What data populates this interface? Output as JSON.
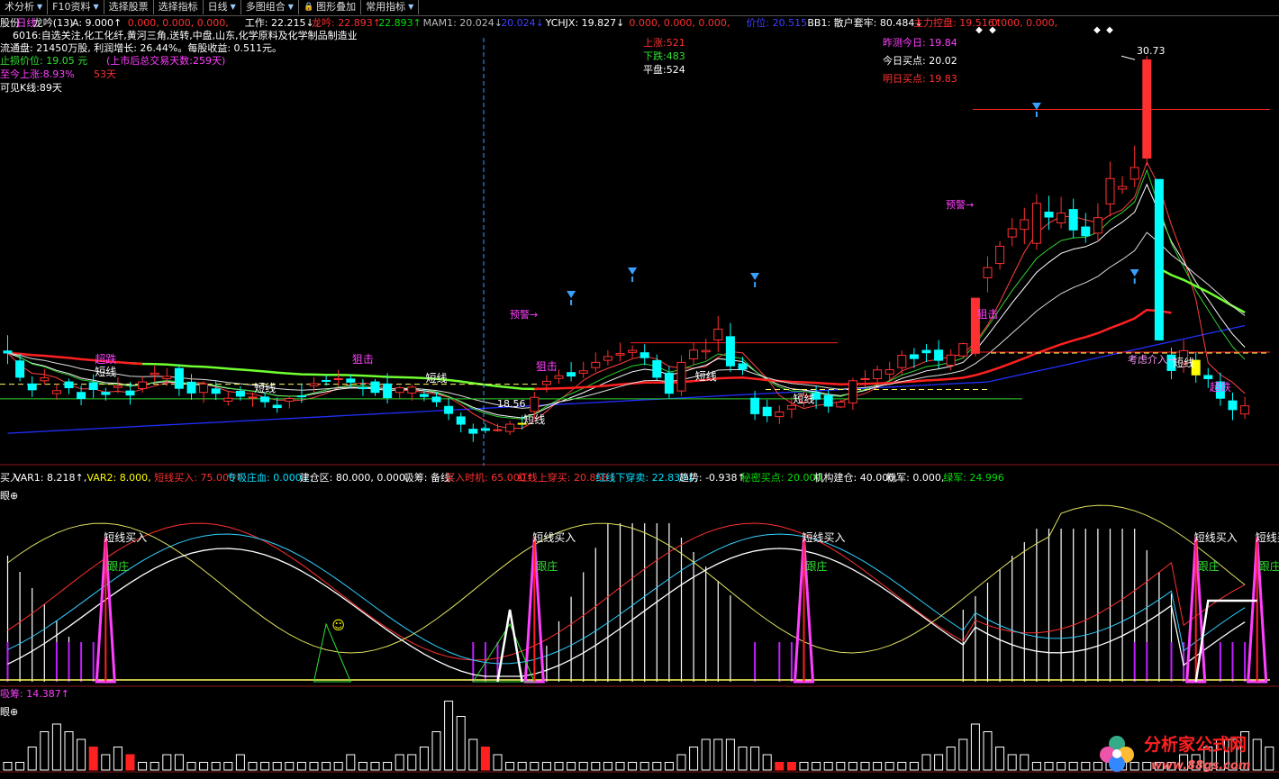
{
  "toolbar": {
    "items": [
      {
        "label": "术分析",
        "icon": "chevron-down-icon"
      },
      {
        "label": "F10资料",
        "icon": "chevron-down-icon"
      },
      {
        "label": "选择股票",
        "icon": ""
      },
      {
        "label": "选择指标",
        "icon": ""
      },
      {
        "label": "日线",
        "icon": "chevron-down-icon"
      },
      {
        "label": "多图组合",
        "icon": "chevron-down-icon"
      },
      {
        "label": "图形叠加",
        "icon": "lock-icon"
      },
      {
        "label": "常用指标",
        "icon": "chevron-down-icon"
      }
    ]
  },
  "header": {
    "line1": [
      {
        "text": "股份",
        "color": "#ffffff"
      },
      {
        "text": "日线",
        "color": "#ff4dff"
      },
      {
        "text": "龙吟(13)",
        "color": "#ffffff"
      },
      {
        "text": "A: 9.000↑",
        "color": "#ffffff"
      },
      {
        "text": "0.000, 0.000, 0.000,",
        "color": "#ff3030"
      },
      {
        "text": "工作: 22.215↓",
        "color": "#ffffff"
      },
      {
        "text": "龙吟: 22.893↑",
        "color": "#ff3030"
      },
      {
        "text": "22.893↑",
        "color": "#00e000"
      },
      {
        "text": "MAM1: 20.024↓",
        "color": "#bbbbbb"
      },
      {
        "text": "20.024↓",
        "color": "#4040ff"
      },
      {
        "text": "YCHJX: 19.827↓",
        "color": "#ffffff"
      },
      {
        "text": "0.000, 0.000, 0.000,",
        "color": "#ff3030"
      },
      {
        "text": "价位: 20.515",
        "color": "#4040ff"
      },
      {
        "text": "BB1: 散户套牢: 80.484↓",
        "color": "#ffffff"
      },
      {
        "text": "主力控盘: 19.516↑",
        "color": "#ff3030"
      },
      {
        "text": "0.000, 0.000,",
        "color": "#ff3030"
      }
    ],
    "concept": {
      "prefix": "6016",
      "text": "自选关注,化工化纤,黄河三角,送转,中盘,山东,化学原料及化学制品制造业"
    },
    "circ": "流通盘: 21450万股, 利润增长: 26.44%。每股收益: 0.511元。",
    "stop": {
      "label": "止损价位: 19.05 元",
      "note": "(上市后总交易天数:259天)"
    },
    "rise": {
      "label": "至今上涨:8.93%",
      "days": "53天"
    },
    "visible": "可见K线:89天"
  },
  "pred": {
    "yesterday": "昨测今日: 19.84",
    "today_buy": "今日买点: 20.02",
    "tomorrow_buy": "明日买点: 19.83"
  },
  "stats": {
    "up": "上涨:521",
    "down": "下跌:483",
    "flat": "平盘:524"
  },
  "annotations": {
    "short": "短线",
    "chaodie": "超跌",
    "zuji": "狙击",
    "yujing": "预警→",
    "kaolv": "考虑介入→",
    "high_price": "30.73",
    "low_price": "18.56"
  },
  "indicator_header": [
    {
      "text": "买入",
      "color": "#ffffff"
    },
    {
      "text": "VAR1: 8.218↑,",
      "color": "#ffffff"
    },
    {
      "text": "VAR2: 8.000,",
      "color": "#ffff00"
    },
    {
      "text": "短线买入: 75.000↑",
      "color": "#ff3030"
    },
    {
      "text": "专吸庄血: 0.000↓,",
      "color": "#00e0ff"
    },
    {
      "text": "建仓区: 80.000, 0.000,",
      "color": "#ffffff"
    },
    {
      "text": "吸筹: 备线:",
      "color": "#ffffff"
    },
    {
      "text": "买入时机: 65.000↑",
      "color": "#ff3030"
    },
    {
      "text": "红线上穿买: 20.858↓",
      "color": "#ff3030"
    },
    {
      "text": "红线下穿卖: 22.839↓,",
      "color": "#00e0ff"
    },
    {
      "text": "趋势: -0.938↑",
      "color": "#ffffff"
    },
    {
      "text": "秘密买点: 20.000,",
      "color": "#00e000"
    },
    {
      "text": "机构建仓: 40.000,",
      "color": "#ffffff"
    },
    {
      "text": "粉军: 0.000,",
      "color": "#ffffff"
    },
    {
      "text": "绿军: 24.996",
      "color": "#00e000"
    }
  ],
  "indicator": {
    "eye": "眼⊕",
    "buy": "短线买入",
    "follow": "跟庄"
  },
  "volume_header": {
    "label": "吸筹: 14.387↑",
    "eye": "眼⊕"
  },
  "logo": {
    "name": "分析家公式网",
    "url": "www.88gs.com"
  },
  "colors": {
    "up": "#ff3030",
    "down": "#00ffff",
    "ma_white": "#ffffff",
    "ma_green": "#70ff30",
    "ma_blue": "#2030ff",
    "ma_red": "#ff2020",
    "magenta": "#ff40ff",
    "yellow": "#ffff00"
  },
  "chart_data": {
    "type": "candlestick",
    "candles": [
      [
        20.62,
        20.55,
        21.16,
        20.17
      ],
      [
        20.28,
        19.72,
        20.52,
        19.58
      ],
      [
        19.49,
        19.29,
        19.75,
        19.04
      ],
      [
        19.6,
        19.7,
        20.0,
        19.47
      ],
      [
        19.16,
        19.26,
        19.49,
        18.95
      ],
      [
        19.56,
        19.36,
        19.67,
        19.14
      ],
      [
        19.2,
        18.99,
        19.43,
        18.76
      ],
      [
        19.53,
        19.3,
        19.82,
        19.01
      ],
      [
        19.2,
        19.13,
        19.36,
        18.92
      ],
      [
        19.37,
        19.43,
        19.72,
        19.17
      ],
      [
        19.25,
        19.11,
        19.56,
        18.78
      ],
      [
        19.33,
        19.56,
        19.77,
        19.19
      ],
      [
        19.81,
        19.86,
        20.11,
        19.56
      ],
      [
        19.67,
        19.75,
        20.03,
        19.42
      ],
      [
        20.02,
        19.34,
        20.17,
        19.08
      ],
      [
        19.55,
        19.18,
        19.83,
        18.95
      ],
      [
        19.2,
        19.49,
        19.59,
        18.84
      ],
      [
        19.32,
        19.17,
        19.59,
        18.94
      ],
      [
        18.9,
        19.0,
        19.25,
        18.75
      ],
      [
        19.24,
        19.07,
        19.41,
        18.92
      ],
      [
        19.04,
        19.04,
        19.2,
        18.7
      ],
      [
        19.04,
        18.88,
        19.18,
        18.68
      ],
      [
        18.76,
        18.68,
        19.02,
        18.5
      ],
      [
        18.9,
        18.99,
        19.08,
        18.65
      ],
      [
        19.08,
        19.07,
        19.51,
        18.84
      ],
      [
        19.43,
        19.5,
        19.72,
        19.19
      ],
      [
        19.61,
        19.58,
        19.81,
        19.43
      ],
      [
        19.66,
        19.67,
        19.98,
        19.4
      ],
      [
        19.66,
        19.55,
        19.81,
        19.35
      ],
      [
        19.36,
        19.34,
        19.66,
        19.08
      ],
      [
        19.56,
        19.2,
        19.66,
        19.08
      ],
      [
        19.49,
        19.02,
        19.86,
        18.82
      ],
      [
        19.2,
        19.36,
        19.41,
        18.98
      ],
      [
        19.18,
        19.38,
        19.47,
        18.92
      ],
      [
        19.13,
        19.06,
        19.3,
        18.9
      ],
      [
        19.04,
        18.88,
        19.2,
        18.7
      ],
      [
        18.72,
        18.48,
        19.0,
        18.25
      ],
      [
        18.36,
        18.11,
        18.51,
        17.83
      ],
      [
        17.94,
        17.8,
        18.13,
        17.5
      ],
      [
        17.96,
        17.9,
        18.13,
        17.8
      ],
      [
        17.9,
        17.92,
        18.13,
        17.85
      ],
      [
        17.86,
        18.11,
        18.22,
        17.74
      ],
      [
        18.14,
        18.12,
        18.41,
        17.93
      ],
      [
        18.55,
        19.03,
        19.22,
        18.28
      ],
      [
        19.47,
        19.58,
        19.78,
        19.2
      ],
      [
        19.68,
        19.77,
        19.98,
        19.5
      ],
      [
        19.88,
        19.76,
        20.24,
        19.58
      ],
      [
        19.86,
        19.94,
        20.25,
        19.69
      ],
      [
        20.05,
        20.23,
        20.57,
        19.91
      ],
      [
        20.3,
        20.43,
        20.65,
        20.13
      ],
      [
        20.48,
        20.53,
        20.91,
        20.26
      ],
      [
        20.57,
        20.64,
        20.81,
        20.36
      ],
      [
        20.56,
        20.39,
        20.85,
        20.13
      ],
      [
        20.29,
        19.72,
        20.5,
        19.62
      ],
      [
        19.86,
        19.17,
        20.1,
        19.0
      ],
      [
        19.25,
        20.23,
        20.47,
        19.08
      ],
      [
        20.35,
        20.65,
        20.91,
        20.14
      ],
      [
        20.59,
        20.64,
        21.04,
        20.33
      ],
      [
        21.0,
        21.37,
        21.82,
        20.59
      ],
      [
        21.11,
        20.11,
        21.58,
        19.9
      ],
      [
        20.18,
        20.0,
        20.42,
        19.8
      ],
      [
        19.0,
        18.47,
        19.25,
        18.25
      ],
      [
        18.69,
        18.4,
        18.95,
        18.18
      ],
      [
        18.37,
        18.53,
        18.76,
        18.11
      ],
      [
        18.63,
        18.75,
        19.04,
        18.32
      ],
      [
        18.87,
        19.09,
        19.26,
        18.69
      ],
      [
        19.18,
        18.97,
        19.44,
        18.64
      ],
      [
        19.09,
        18.73,
        19.27,
        18.5
      ],
      [
        18.7,
        18.87,
        18.94,
        18.66
      ],
      [
        18.84,
        19.6,
        19.7,
        18.6
      ],
      [
        19.65,
        19.67,
        19.96,
        19.39
      ],
      [
        19.67,
        19.97,
        20.12,
        19.46
      ],
      [
        19.83,
        19.98,
        20.25,
        19.62
      ],
      [
        20.05,
        20.47,
        20.64,
        19.81
      ],
      [
        20.49,
        20.36,
        20.72,
        20.04
      ],
      [
        20.64,
        20.56,
        20.86,
        20.24
      ],
      [
        20.65,
        20.3,
        20.99,
        20.01
      ],
      [
        20.13,
        20.48,
        20.67,
        19.96
      ],
      [
        20.45,
        20.87,
        20.91,
        20.37
      ],
      [
        20.54,
        22.43,
        22.43,
        20.43
      ],
      [
        23.13,
        23.48,
        23.86,
        22.63
      ],
      [
        23.62,
        24.21,
        24.38,
        23.41
      ],
      [
        24.53,
        24.81,
        25.18,
        24.21
      ],
      [
        24.79,
        25.12,
        25.53,
        24.28
      ],
      [
        24.31,
        25.68,
        26.0,
        24.09
      ],
      [
        25.38,
        25.21,
        25.94,
        24.77
      ],
      [
        25.01,
        25.35,
        25.9,
        24.82
      ],
      [
        25.47,
        24.77,
        25.84,
        24.48
      ],
      [
        24.87,
        24.57,
        25.35,
        24.33
      ],
      [
        24.66,
        25.19,
        25.68,
        24.36
      ],
      [
        25.66,
        26.53,
        27.11,
        25.24
      ],
      [
        26.17,
        26.26,
        26.61,
        26.0
      ],
      [
        26.51,
        26.91,
        27.66,
        26.24
      ],
      [
        27.23,
        30.6,
        30.73,
        26.98
      ],
      [
        26.5,
        21.0,
        26.5,
        20.98
      ],
      [
        20.48,
        19.95,
        20.74,
        19.65
      ],
      [
        20.21,
        20.63,
        21.0,
        19.87
      ],
      [
        20.3,
        19.8,
        20.58,
        19.53
      ],
      [
        19.78,
        19.67,
        20.04,
        19.35
      ],
      [
        19.56,
        19.0,
        19.88,
        18.74
      ],
      [
        18.91,
        18.61,
        19.19,
        18.25
      ],
      [
        18.46,
        18.74,
        19.05,
        18.29
      ]
    ],
    "volume": [
      1,
      1,
      3,
      5,
      6,
      5,
      4,
      3,
      2,
      3,
      2,
      1,
      1,
      2,
      2,
      1,
      1,
      1,
      1,
      2,
      1,
      1,
      1,
      1,
      1,
      1,
      1,
      1,
      2,
      1,
      1,
      1,
      2,
      2,
      3,
      5,
      9,
      7,
      4,
      3,
      2,
      1,
      1,
      1,
      1,
      1,
      1,
      1,
      1,
      1,
      1,
      1,
      1,
      1,
      1,
      2,
      3,
      4,
      4,
      4,
      3,
      3,
      2,
      1,
      1,
      1,
      1,
      1,
      1,
      1,
      1,
      1,
      1,
      1,
      1,
      2,
      2,
      3,
      4,
      6,
      5,
      3,
      2,
      2,
      1,
      1,
      1,
      1,
      1,
      1,
      1,
      1,
      1,
      1,
      1,
      1,
      2,
      2,
      3,
      4,
      4,
      5,
      4,
      3
    ]
  }
}
